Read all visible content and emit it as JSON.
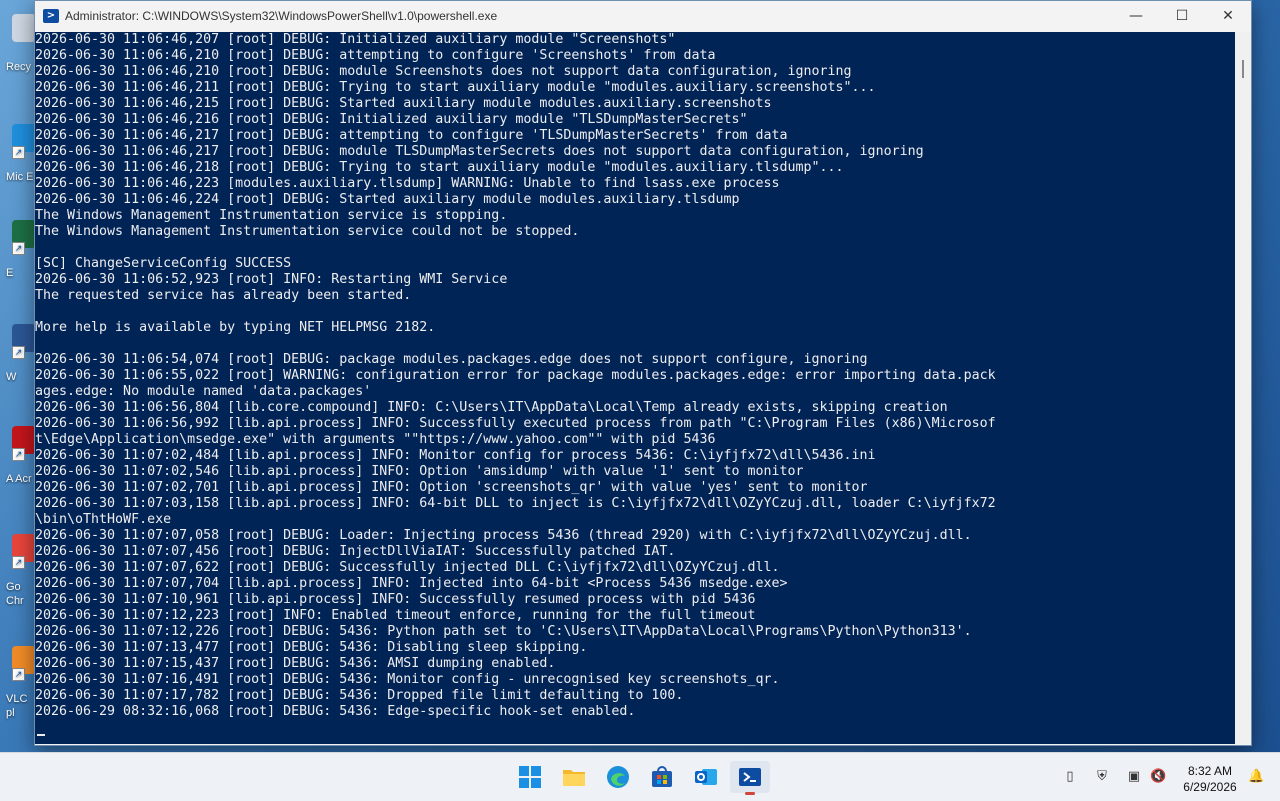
{
  "window": {
    "title": "Administrator: C:\\WINDOWS\\System32\\WindowsPowerShell\\v1.0\\powershell.exe",
    "buttons": {
      "minimize": "—",
      "maximize": "☐",
      "close": "✕"
    }
  },
  "desktop_icons": [
    {
      "label": "Recy",
      "name": "recycle-bin-icon"
    },
    {
      "label": "Mic E",
      "name": "microsoft-edge-shortcut-icon"
    },
    {
      "label": "E",
      "name": "excel-shortcut-icon"
    },
    {
      "label": "W",
      "name": "word-shortcut-icon"
    },
    {
      "label": "A Acr",
      "name": "adobe-acrobat-shortcut-icon"
    },
    {
      "label": "Go Chr",
      "name": "google-chrome-shortcut-icon"
    },
    {
      "label": "VLC pl",
      "name": "vlc-player-shortcut-icon"
    }
  ],
  "console": {
    "lines": [
      "2026-06-30 11:06:46,207 [root] DEBUG: Initialized auxiliary module \"Screenshots\"",
      "2026-06-30 11:06:46,210 [root] DEBUG: attempting to configure 'Screenshots' from data",
      "2026-06-30 11:06:46,210 [root] DEBUG: module Screenshots does not support data configuration, ignoring",
      "2026-06-30 11:06:46,211 [root] DEBUG: Trying to start auxiliary module \"modules.auxiliary.screenshots\"...",
      "2026-06-30 11:06:46,215 [root] DEBUG: Started auxiliary module modules.auxiliary.screenshots",
      "2026-06-30 11:06:46,216 [root] DEBUG: Initialized auxiliary module \"TLSDumpMasterSecrets\"",
      "2026-06-30 11:06:46,217 [root] DEBUG: attempting to configure 'TLSDumpMasterSecrets' from data",
      "2026-06-30 11:06:46,217 [root] DEBUG: module TLSDumpMasterSecrets does not support data configuration, ignoring",
      "2026-06-30 11:06:46,218 [root] DEBUG: Trying to start auxiliary module \"modules.auxiliary.tlsdump\"...",
      "2026-06-30 11:06:46,223 [modules.auxiliary.tlsdump] WARNING: Unable to find lsass.exe process",
      "2026-06-30 11:06:46,224 [root] DEBUG: Started auxiliary module modules.auxiliary.tlsdump",
      "The Windows Management Instrumentation service is stopping.",
      "The Windows Management Instrumentation service could not be stopped.",
      "",
      "[SC] ChangeServiceConfig SUCCESS",
      "2026-06-30 11:06:52,923 [root] INFO: Restarting WMI Service",
      "The requested service has already been started.",
      "",
      "More help is available by typing NET HELPMSG 2182.",
      "",
      "2026-06-30 11:06:54,074 [root] DEBUG: package modules.packages.edge does not support configure, ignoring",
      "2026-06-30 11:06:55,022 [root] WARNING: configuration error for package modules.packages.edge: error importing data.pack",
      "ages.edge: No module named 'data.packages'",
      "2026-06-30 11:06:56,804 [lib.core.compound] INFO: C:\\Users\\IT\\AppData\\Local\\Temp already exists, skipping creation",
      "2026-06-30 11:06:56,992 [lib.api.process] INFO: Successfully executed process from path \"C:\\Program Files (x86)\\Microsof",
      "t\\Edge\\Application\\msedge.exe\" with arguments \"\"https://www.yahoo.com\"\" with pid 5436",
      "2026-06-30 11:07:02,484 [lib.api.process] INFO: Monitor config for process 5436: C:\\iyfjfx72\\dll\\5436.ini",
      "2026-06-30 11:07:02,546 [lib.api.process] INFO: Option 'amsidump' with value '1' sent to monitor",
      "2026-06-30 11:07:02,701 [lib.api.process] INFO: Option 'screenshots_qr' with value 'yes' sent to monitor",
      "2026-06-30 11:07:03,158 [lib.api.process] INFO: 64-bit DLL to inject is C:\\iyfjfx72\\dll\\OZyYCzuj.dll, loader C:\\iyfjfx72",
      "\\bin\\oThtHoWF.exe",
      "2026-06-30 11:07:07,058 [root] DEBUG: Loader: Injecting process 5436 (thread 2920) with C:\\iyfjfx72\\dll\\OZyYCzuj.dll.",
      "2026-06-30 11:07:07,456 [root] DEBUG: InjectDllViaIAT: Successfully patched IAT.",
      "2026-06-30 11:07:07,622 [root] DEBUG: Successfully injected DLL C:\\iyfjfx72\\dll\\OZyYCzuj.dll.",
      "2026-06-30 11:07:07,704 [lib.api.process] INFO: Injected into 64-bit <Process 5436 msedge.exe>",
      "2026-06-30 11:07:10,961 [lib.api.process] INFO: Successfully resumed process with pid 5436",
      "2026-06-30 11:07:12,223 [root] INFO: Enabled timeout enforce, running for the full timeout",
      "2026-06-30 11:07:12,226 [root] DEBUG: 5436: Python path set to 'C:\\Users\\IT\\AppData\\Local\\Programs\\Python\\Python313'.",
      "2026-06-30 11:07:13,477 [root] DEBUG: 5436: Disabling sleep skipping.",
      "2026-06-30 11:07:15,437 [root] DEBUG: 5436: AMSI dumping enabled.",
      "2026-06-30 11:07:16,491 [root] DEBUG: 5436: Monitor config - unrecognised key screenshots_qr.",
      "2026-06-30 11:07:17,782 [root] DEBUG: 5436: Dropped file limit defaulting to 100.",
      "2026-06-29 08:32:16,068 [root] DEBUG: 5436: Edge-specific hook-set enabled."
    ]
  },
  "taskbar": {
    "apps": [
      {
        "name": "start-button",
        "icon": "windows-logo-icon",
        "active": false
      },
      {
        "name": "taskbar-file-explorer",
        "icon": "folder-icon",
        "active": false
      },
      {
        "name": "taskbar-edge",
        "icon": "edge-icon",
        "active": false
      },
      {
        "name": "taskbar-microsoft-store",
        "icon": "store-icon",
        "active": false
      },
      {
        "name": "taskbar-outlook",
        "icon": "outlook-icon",
        "active": false
      },
      {
        "name": "taskbar-powershell",
        "icon": "powershell-icon",
        "active": true
      }
    ],
    "tray": [
      {
        "name": "usb-icon",
        "glyph": "▯"
      },
      {
        "name": "security-icon",
        "glyph": "⛨"
      },
      {
        "name": "network-icon",
        "glyph": "▣"
      },
      {
        "name": "volume-muted-icon",
        "glyph": "🔇"
      }
    ],
    "time": "8:32 AM",
    "date": "6/29/2026",
    "notification_glyph": "🔔"
  },
  "colors": {
    "console_bg": "#012456",
    "console_text": "#eeedf0",
    "accent_active": "#d0473a"
  }
}
